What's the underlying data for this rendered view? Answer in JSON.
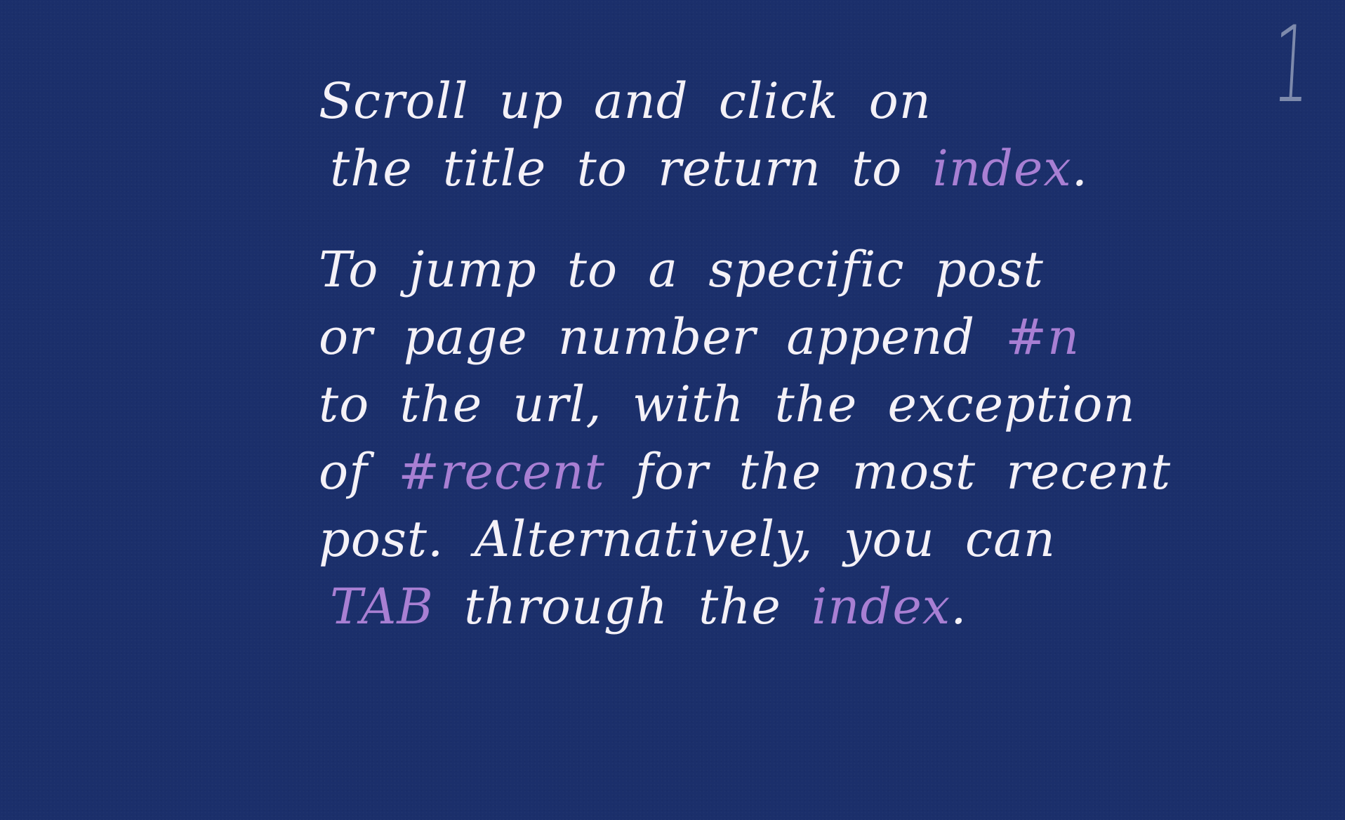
{
  "page": {
    "number": "1",
    "background_color": "#1b2f6b",
    "text_color": "#f4f1f7",
    "accent_color": "#a87fd3"
  },
  "note": {
    "paragraph1": {
      "line1": "Scroll up and click on",
      "line2_prefix": "the title to return to ",
      "line2_link": "index",
      "line2_suffix": "."
    },
    "paragraph2": {
      "line1": "To jump to a specific post",
      "line2_prefix": "or page number append ",
      "line2_code": "#n",
      "line3": "to the url, with the exception",
      "line4_prefix": "of ",
      "line4_code": "#recent",
      "line4_suffix": " for the most recent",
      "line5": "post. Alternatively, you can",
      "line6_key": "TAB",
      "line6_middle": " through the ",
      "line6_link": "index",
      "line6_suffix": "."
    }
  }
}
